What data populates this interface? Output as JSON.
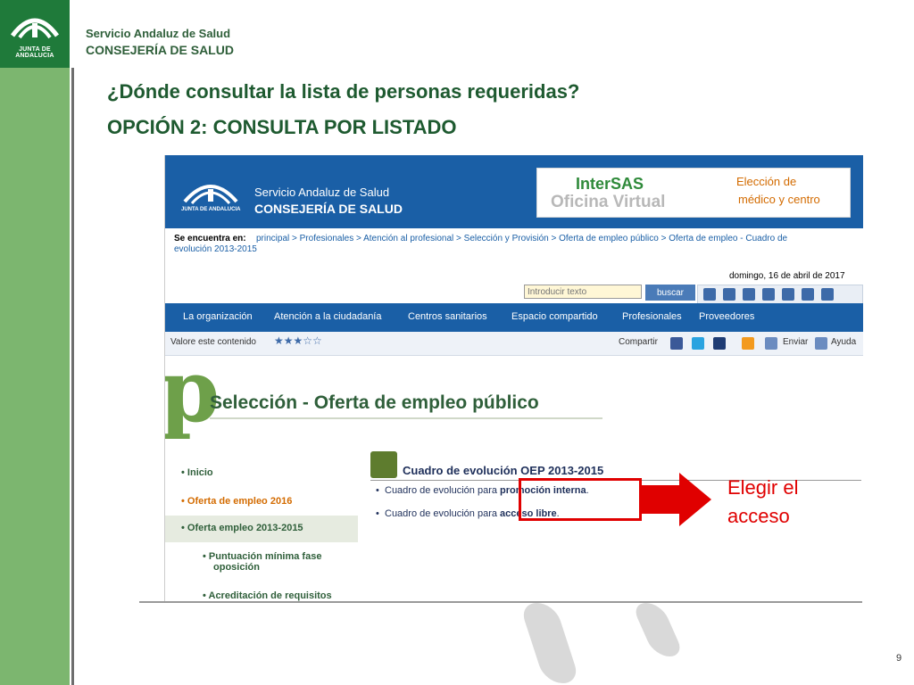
{
  "slide": {
    "brand_line1": "Servicio Andaluz de Salud",
    "brand_line2": "CONSEJERÍA DE SALUD",
    "logo_caption": "JUNTA DE ANDALUCIA",
    "title_line1": "¿Dónde consultar la lista de personas requeridas?",
    "title_line2": "OPCIÓN 2: CONSULTA POR LISTADO",
    "page_number": "9"
  },
  "site": {
    "header": {
      "brand_line1": "Servicio Andaluz de Salud",
      "brand_line2": "CONSEJERÍA DE SALUD",
      "logo_caption": "JUNTA DE ANDALUCIA",
      "intersas": "InterSAS",
      "oficina": "Oficina Virtual",
      "eleccion_line1": "Elección de",
      "eleccion_line2": "médico y centro"
    },
    "breadcrumb": {
      "label": "Se encuentra en:",
      "line1": "principal > Profesionales > Atención al profesional > Selección y Provisión > Oferta de empleo público > Oferta de empleo - Cuadro de",
      "line2": "evolución 2013-2015"
    },
    "date": "domingo, 16 de abril de 2017",
    "search": {
      "placeholder": "Introducir texto",
      "button": "buscar"
    },
    "nav": [
      "La organización",
      "Atención a la ciudadanía",
      "Centros sanitarios",
      "Espacio compartido",
      "Profesionales",
      "Proveedores"
    ],
    "util": {
      "rate_label": "Valore este contenido",
      "stars": "★★★☆☆",
      "share": "Compartir",
      "send": "Enviar",
      "help": "Ayuda"
    },
    "section": {
      "letter": "p",
      "title": "Selección - Oferta de empleo público"
    },
    "left_nav": {
      "inicio": "Inicio",
      "oferta_2016": "Oferta de empleo 2016",
      "oferta_2013": "Oferta empleo 2013-2015",
      "puntuacion_1": "Puntuación mínima fase",
      "puntuacion_2": "oposición",
      "acreditacion": "Acreditación de requisitos"
    },
    "content": {
      "title": "Cuadro de evolución OEP 2013-2015",
      "item1_prefix": "Cuadro de evolución para ",
      "item1_link": "promoción interna",
      "item1_suffix": ".",
      "item2_prefix": "Cuadro de evolución para ",
      "item2_link": "acceso libre",
      "item2_suffix": "."
    }
  },
  "annotation": {
    "line1": "Elegir el",
    "line2": "acceso"
  },
  "colors": {
    "green_bar": "#7cb66f",
    "site_blue": "#1a5fa6",
    "red": "#e00000"
  }
}
